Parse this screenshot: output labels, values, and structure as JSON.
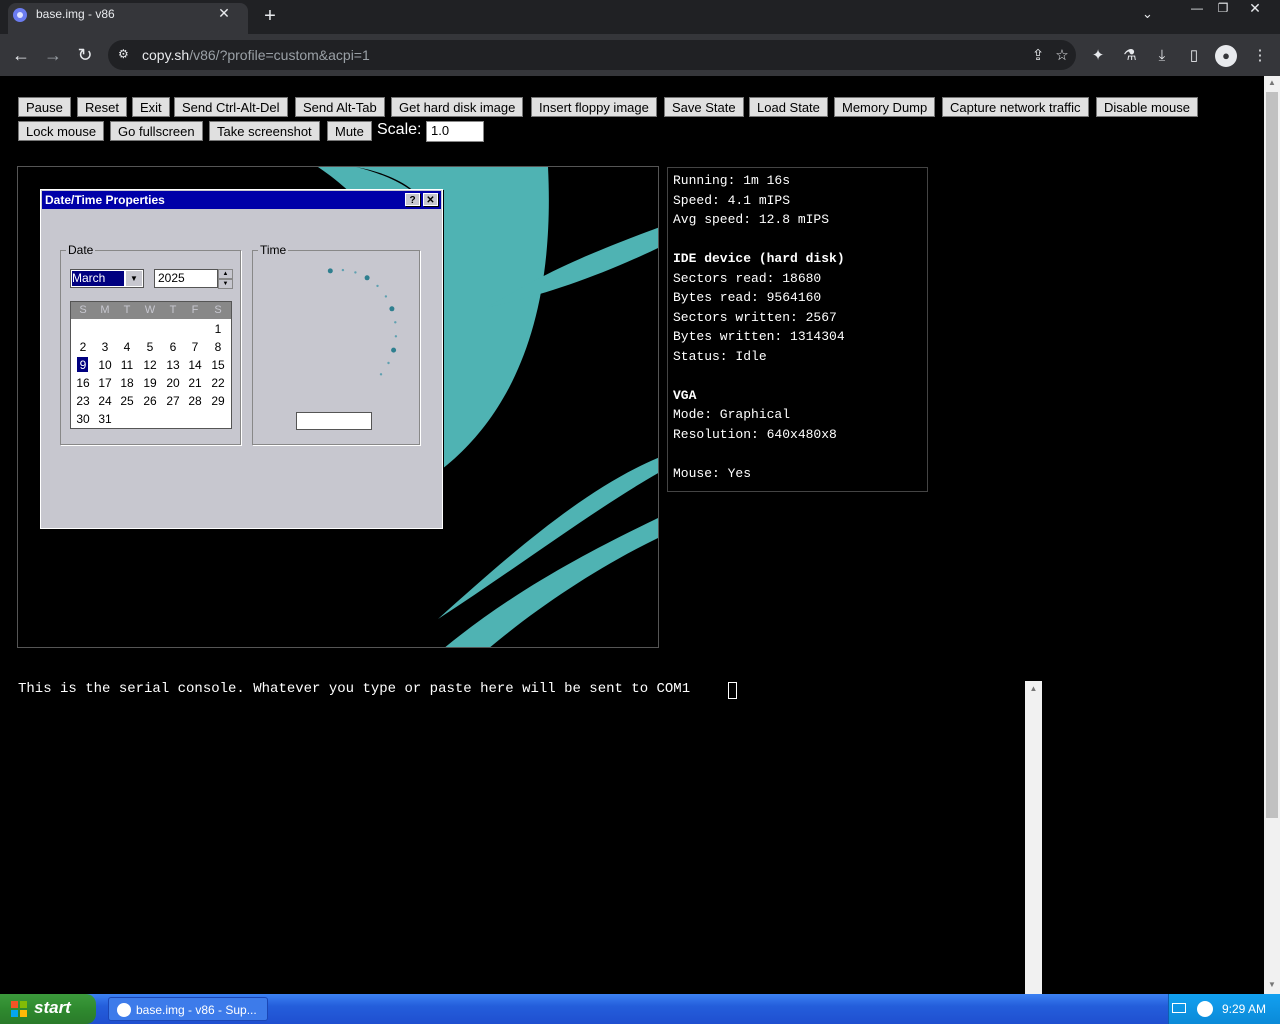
{
  "browser": {
    "tab_title": "base.img - v86",
    "url_host": "copy.sh",
    "url_path": "/v86/?profile=custom&acpi=1"
  },
  "controls": {
    "buttons_row1": [
      "Pause",
      "Reset",
      "Exit",
      "Send Ctrl-Alt-Del",
      "Send Alt-Tab",
      "Get hard disk image",
      "Insert floppy image",
      "Save State",
      "Load State",
      "Memory Dump",
      "Capture network traffic",
      "Disable mouse"
    ],
    "buttons_row2": [
      "Lock mouse",
      "Go fullscreen",
      "Take screenshot",
      "Mute"
    ],
    "scale_label": "Scale:",
    "scale_value": "1.0"
  },
  "dialog": {
    "title": "Date/Time Properties",
    "help_button": "?",
    "close_button": "✕",
    "date_group_label": "Date",
    "time_group_label": "Time",
    "month": "March",
    "year": "2025",
    "day_names": [
      "S",
      "M",
      "T",
      "W",
      "T",
      "F",
      "S"
    ],
    "weeks": [
      [
        "",
        "",
        "",
        "",
        "",
        "",
        "1"
      ],
      [
        "2",
        "3",
        "4",
        "5",
        "6",
        "7",
        "8"
      ],
      [
        "9",
        "10",
        "11",
        "12",
        "13",
        "14",
        "15"
      ],
      [
        "16",
        "17",
        "18",
        "19",
        "20",
        "21",
        "22"
      ],
      [
        "23",
        "24",
        "25",
        "26",
        "27",
        "28",
        "29"
      ],
      [
        "30",
        "31",
        "",
        "",
        "",
        "",
        ""
      ]
    ],
    "selected_day": "9"
  },
  "stats": {
    "running": "Running: 1m 16s",
    "speed": "Speed: 4.1 mIPS",
    "avg_speed": "Avg speed: 12.8 mIPS",
    "ide_heading": "IDE device (hard disk)",
    "sectors_read": "Sectors read: 18680",
    "bytes_read": "Bytes read: 9564160",
    "sectors_written": "Sectors written: 2567",
    "bytes_written": "Bytes written: 1314304",
    "status": "Status: Idle",
    "vga_heading": "VGA",
    "mode": "Mode: Graphical",
    "resolution": "Resolution: 640x480x8",
    "mouse": "Mouse: Yes"
  },
  "serial": {
    "text": "This is the serial console. Whatever you type or paste here will be sent to COM1"
  },
  "taskbar": {
    "start_label": "start",
    "task_label": "base.img - v86 - Sup...",
    "clock": "9:29 AM"
  },
  "colors": {
    "teal": "#4fb3b3",
    "xp_title": "#0000a8",
    "taskbar_blue": "#245edb",
    "start_green": "#2f8a2f"
  }
}
